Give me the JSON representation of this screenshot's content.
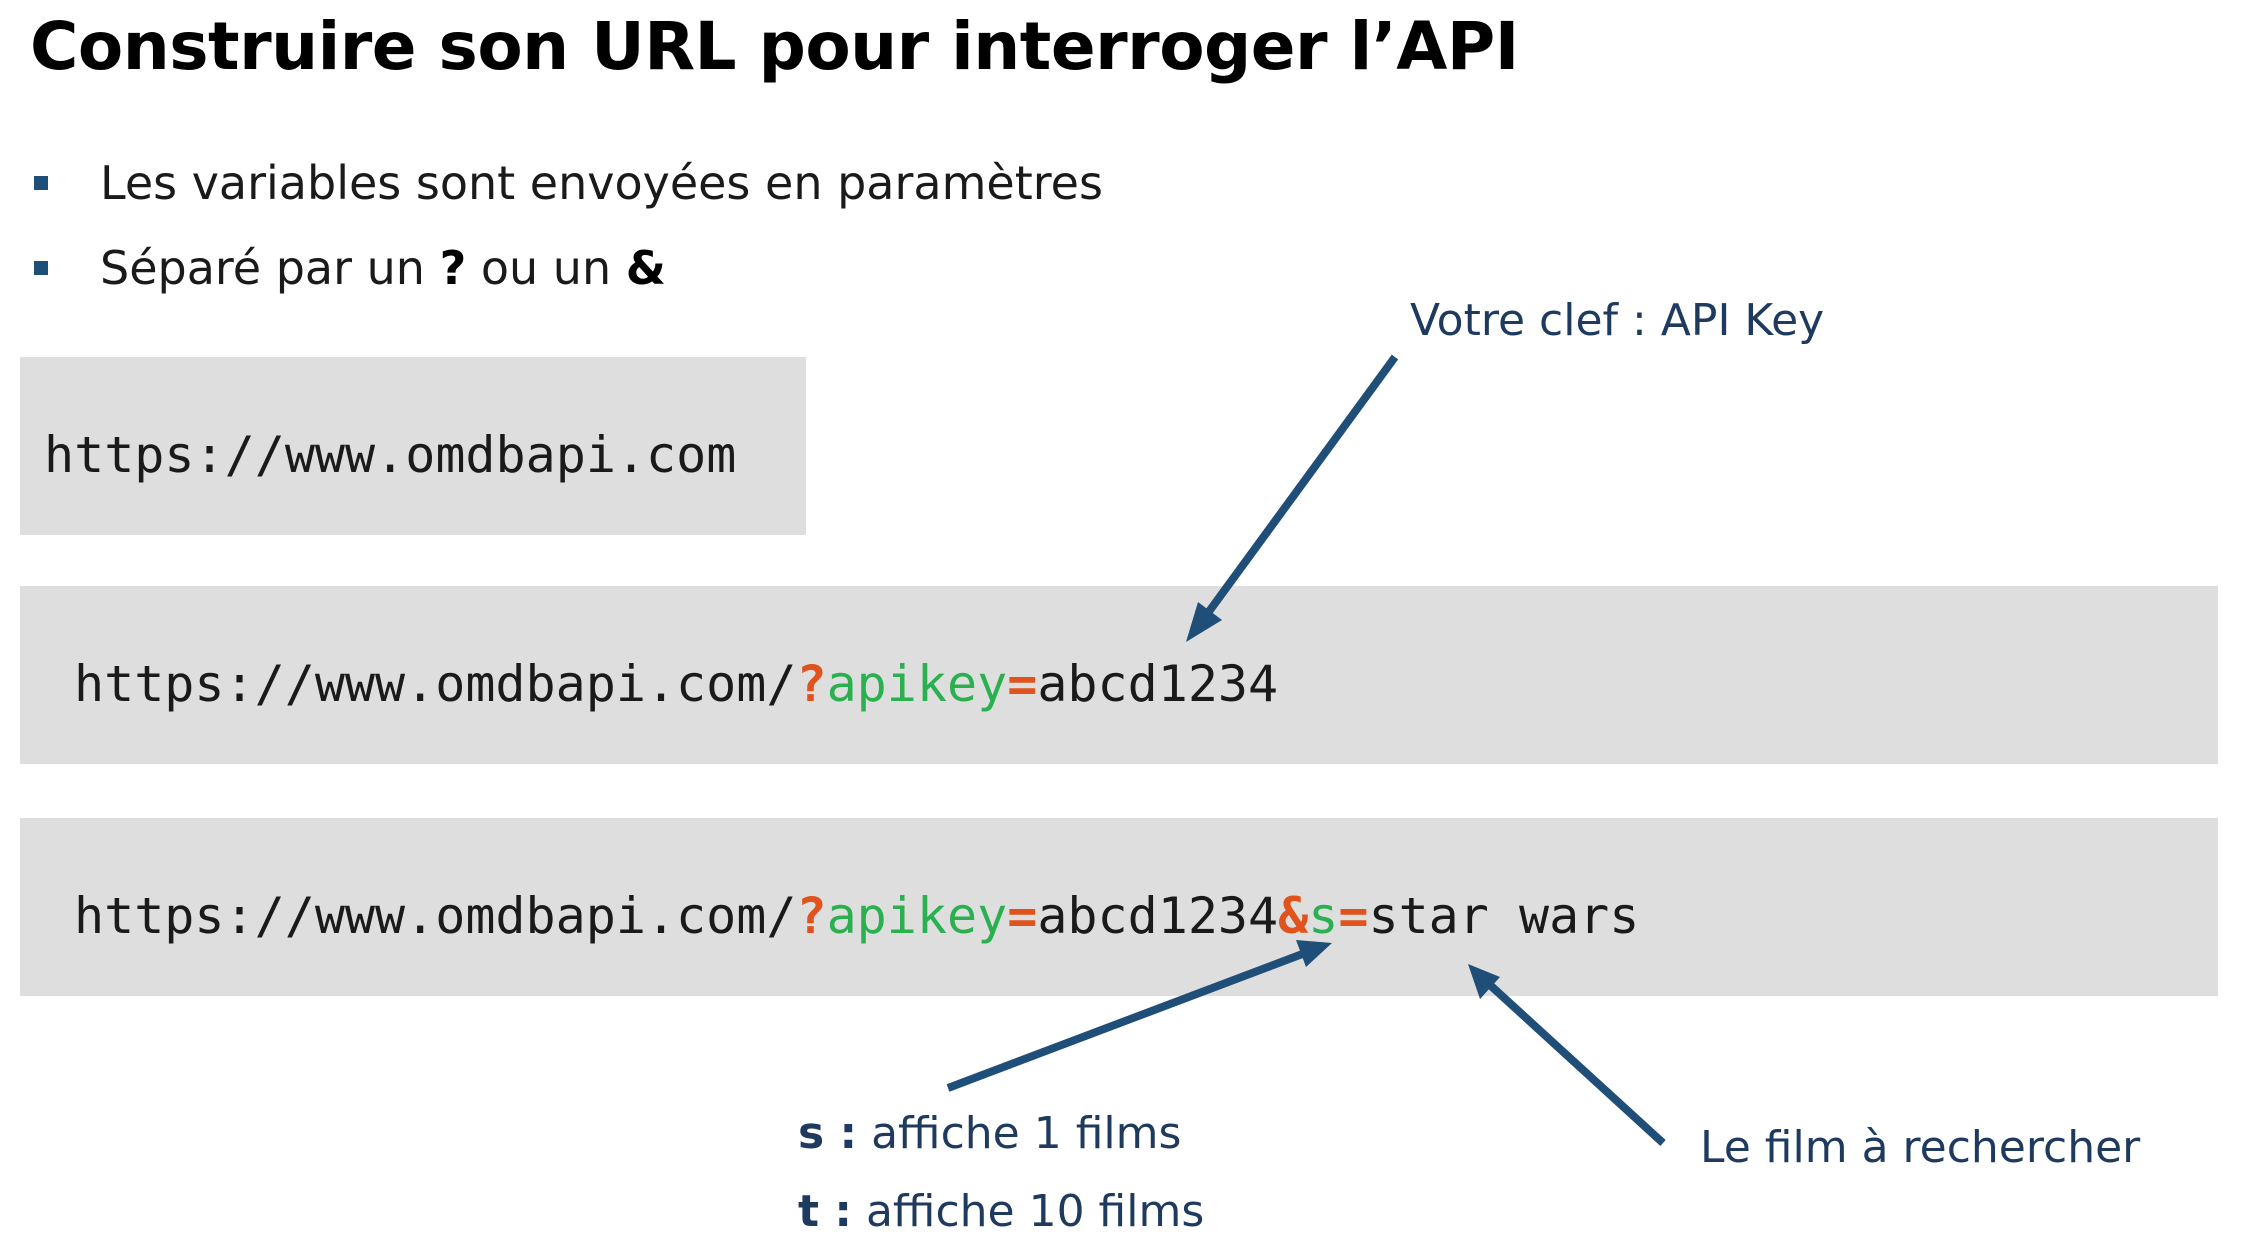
{
  "title": "Construire son URL pour interroger l’API",
  "bullets": [
    {
      "text": "Les variables sont envoyées en paramètres"
    },
    {
      "prefix": "Séparé par un ",
      "q": "?",
      "middle": " ou un ",
      "amp": "&"
    }
  ],
  "urls": {
    "base": "https://www.omdbapi.com",
    "u2": {
      "base": "https://www.omdbapi.com/",
      "q": "?",
      "key": "apikey",
      "eq": "=",
      "val": "abcd1234"
    },
    "u3": {
      "base": "https://www.omdbapi.com/",
      "q": "?",
      "key": "apikey",
      "eq": "=",
      "val": "abcd1234",
      "amp": "&",
      "s": "s",
      "eq2": "=",
      "sval": "star wars"
    }
  },
  "annotations": {
    "api_key": "Votre clef : API Key",
    "s_label": "s :",
    "s_text": " affiche 1 films",
    "t_label": "t :",
    "t_text": " affiche 10 films",
    "film": "Le film à rechercher"
  },
  "colors": {
    "accent_arrow": "#1f4e79",
    "operator": "#e0531d",
    "param": "#2bb04f",
    "box": "#dedede"
  }
}
